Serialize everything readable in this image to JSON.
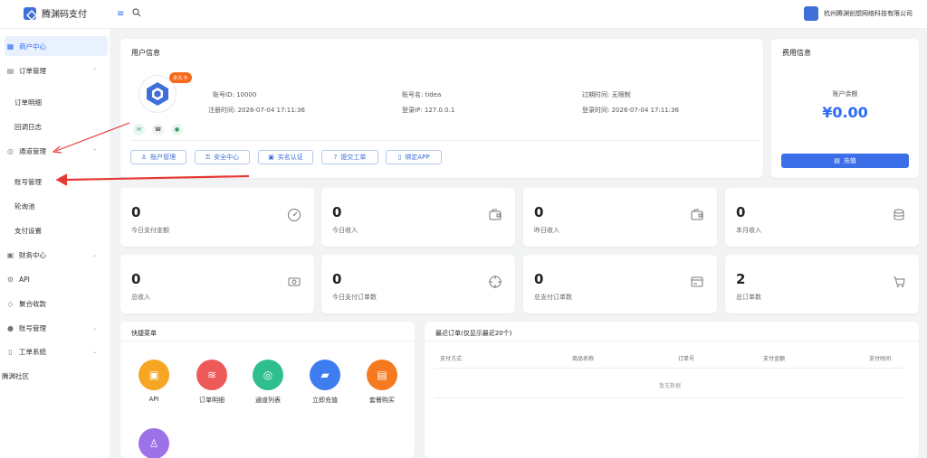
{
  "app": {
    "title": "腾渊码支付",
    "company": "杭州腾渊创想网络科技有限公司"
  },
  "topbar": {
    "menu_icon": "menu-icon",
    "search_icon": "search-icon"
  },
  "sidebar": {
    "items": [
      {
        "label": "商户中心",
        "icon": "dashboard-icon",
        "active": true
      },
      {
        "label": "订单管理",
        "icon": "order-icon",
        "caret": "up"
      },
      {
        "label": "订单明细",
        "sub": true
      },
      {
        "label": "回调日志",
        "sub": true
      },
      {
        "label": "通道管理",
        "icon": "globe-icon",
        "caret": "up"
      },
      {
        "label": "账号管理",
        "sub": true
      },
      {
        "label": "轮询池",
        "sub": true
      },
      {
        "label": "支付设置",
        "sub": true
      },
      {
        "label": "财务中心",
        "icon": "finance-icon",
        "caret": "down"
      },
      {
        "label": "API",
        "icon": "gear-icon"
      },
      {
        "label": "聚合收款",
        "icon": "wallet-icon"
      },
      {
        "label": "账号管理",
        "icon": "user-icon",
        "caret": "down"
      },
      {
        "label": "工单系统",
        "icon": "book-icon",
        "caret": "down"
      },
      {
        "label": "腾渊社区"
      }
    ]
  },
  "user_info": {
    "title": "用户信息",
    "badge": "永久卡",
    "account_id_label": "账号ID:",
    "account_id": "10000",
    "register_time_label": "注册时间:",
    "register_time": "2026-07-04 17:11:36",
    "account_name_label": "账号名:",
    "account_name": "tidea",
    "login_ip_label": "登录IP:",
    "login_ip": "127.0.0.1",
    "expire_label": "过期时间:",
    "expire": "无限制",
    "login_time_label": "登录时间:",
    "login_time": "2026-07-04 17:11:36",
    "actions": [
      "账户管理",
      "安全中心",
      "实名认证",
      "提交工单",
      "绑定APP"
    ]
  },
  "fee": {
    "title": "费用信息",
    "balance_label": "账户余额",
    "balance": "¥0.00",
    "recharge": "充值"
  },
  "stats": [
    {
      "value": "0",
      "label": "今日支付金额",
      "icon": "gauge-icon"
    },
    {
      "value": "0",
      "label": "今日收入",
      "icon": "wallet-icon"
    },
    {
      "value": "0",
      "label": "昨日收入",
      "icon": "wallet-icon"
    },
    {
      "value": "0",
      "label": "本月收入",
      "icon": "database-icon"
    },
    {
      "value": "0",
      "label": "总收入",
      "icon": "cash-icon"
    },
    {
      "value": "0",
      "label": "今日支付订单数",
      "icon": "target-icon"
    },
    {
      "value": "0",
      "label": "总支付订单数",
      "icon": "card-icon"
    },
    {
      "value": "2",
      "label": "总订单数",
      "icon": "cart-icon"
    }
  ],
  "quick": {
    "title": "快捷菜单",
    "items": [
      {
        "label": "API",
        "color": "#f6a623",
        "icon": "chip-icon"
      },
      {
        "label": "订单明细",
        "color": "#ee5a5a",
        "icon": "database-icon"
      },
      {
        "label": "通道列表",
        "color": "#2fbf8c",
        "icon": "channel-icon"
      },
      {
        "label": "立即充值",
        "color": "#3d7df0",
        "icon": "wallet-icon"
      },
      {
        "label": "套餐购买",
        "color": "#f57a1f",
        "icon": "clipboard-icon"
      },
      {
        "label": "",
        "color": "#9d72e8",
        "icon": "user-icon"
      }
    ]
  },
  "orders": {
    "title": "最近订单(仅显示最近20个)",
    "columns": [
      "支付方式",
      "商品名称",
      "订单号",
      "支付金额",
      "支付时间"
    ],
    "empty": "暂无数据"
  },
  "theme": {
    "accent": "#2d6cf2",
    "badge": "#f56a1d",
    "annotation": "#e53935"
  }
}
